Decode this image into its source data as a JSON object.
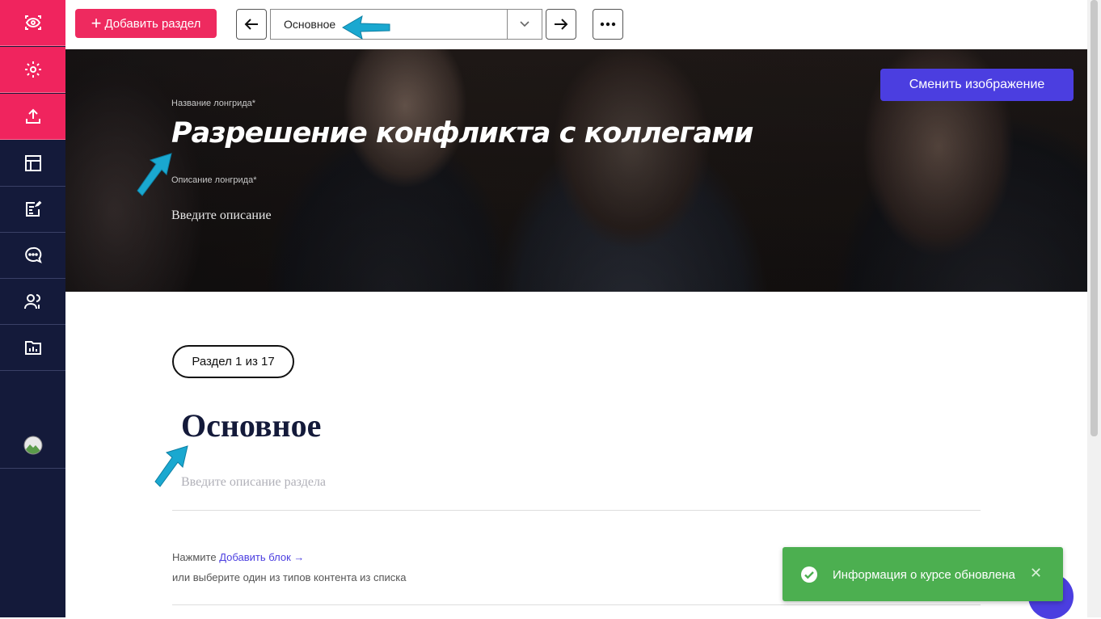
{
  "sidebar": {
    "icons": [
      "eye-scan-icon",
      "gear-icon",
      "upload-icon",
      "layout-icon",
      "edit-list-icon",
      "chat-icon",
      "users-icon",
      "report-icon",
      "avatar"
    ]
  },
  "toolbar": {
    "add_section_label": "Добавить раздел",
    "section_select_value": "Основное"
  },
  "hero": {
    "title_label": "Название лонгрида*",
    "title": "Разрешение конфликта с коллегами",
    "description_label": "Описание лонгрида*",
    "description_placeholder": "Введите описание",
    "change_image_label": "Сменить изображение"
  },
  "section": {
    "badge": "Раздел 1 из 17",
    "title": "Основное",
    "description_placeholder": "Введите описание раздела",
    "hint_prefix": "Нажмите",
    "hint_link": "Добавить блок →",
    "hint_line2": "или выберите один из типов контента из списка"
  },
  "toast": {
    "message": "Информация о курсе обновлена",
    "close": "✕"
  },
  "colors": {
    "sidebar_bg": "#141a3a",
    "accent_pink": "#f0245e",
    "accent_purple": "#4b3ee0",
    "toast_green": "#4caf50",
    "annotation_arrow": "#1aa8d0"
  }
}
